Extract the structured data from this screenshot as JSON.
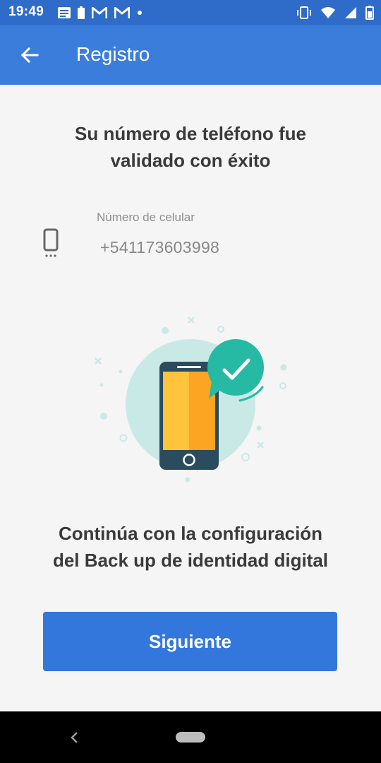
{
  "status_bar": {
    "time": "19:49",
    "left_icons": [
      "news-icon",
      "battery-saver-icon",
      "gmail-icon",
      "gmail-icon",
      "notification-dot-icon"
    ],
    "right_icons": [
      "vibrate-icon",
      "wifi-icon",
      "signal-icon",
      "battery-icon"
    ]
  },
  "app_bar": {
    "title": "Registro",
    "back_icon": "arrow-left-icon",
    "background": "#3b7ddb"
  },
  "main": {
    "success_line1": "Su número de teléfono fue",
    "success_line2": "validado con éxito",
    "phone_label": "Número de celular",
    "phone_value": "+541173603998",
    "phone_icon": "smartphone-icon",
    "illustration": "phone-validated-illustration",
    "continue_line1": "Continúa con la configuración",
    "continue_line2": "del Back up de identidad digital"
  },
  "actions": {
    "next_label": "Siguiente",
    "button_color": "#3377dd"
  },
  "nav_bar": {
    "back_icon": "chevron-left-icon",
    "home_icon": "home-pill-icon"
  }
}
